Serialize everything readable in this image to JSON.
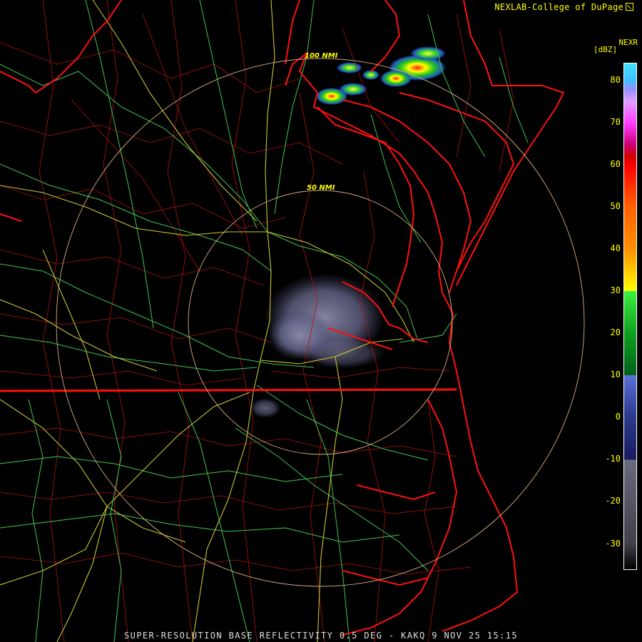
{
  "header": {
    "credit": "NEXLAB-College of DuPage",
    "credit_icon": "external-link-icon",
    "product_code": "NEXR",
    "unit": "[dBZ]"
  },
  "footer": {
    "caption": "SUPER-RESOLUTION BASE REFLECTIVITY 0.5 DEG - KAKQ 9 NOV 25 15:15"
  },
  "range_rings": [
    {
      "label": "50 NMI",
      "nmi": 50
    },
    {
      "label": "100 NMI",
      "nmi": 100
    }
  ],
  "colorbar": {
    "ticks": [
      80,
      70,
      60,
      50,
      40,
      30,
      20,
      10,
      0,
      -10,
      -20,
      -30
    ],
    "range": [
      -36,
      84
    ],
    "stops": [
      {
        "dbz": -36,
        "color": "#000000"
      },
      {
        "dbz": -30,
        "color": "#404048"
      },
      {
        "dbz": -10,
        "color": "#6a6a80"
      },
      {
        "dbz": -10,
        "color": "#1a1a60"
      },
      {
        "dbz": 0,
        "color": "#2a3a8a"
      },
      {
        "dbz": 10,
        "color": "#5a70d8"
      },
      {
        "dbz": 10,
        "color": "#006018"
      },
      {
        "dbz": 20,
        "color": "#10a020"
      },
      {
        "dbz": 30,
        "color": "#40f040"
      },
      {
        "dbz": 30,
        "color": "#ffff00"
      },
      {
        "dbz": 40,
        "color": "#ff9000"
      },
      {
        "dbz": 50,
        "color": "#ff6000"
      },
      {
        "dbz": 60,
        "color": "#ff0000"
      },
      {
        "dbz": 62,
        "color": "#d00000"
      },
      {
        "dbz": 65,
        "color": "#cc0080"
      },
      {
        "dbz": 70,
        "color": "#ff40ff"
      },
      {
        "dbz": 75,
        "color": "#e0a0ff"
      },
      {
        "dbz": 78,
        "color": "#9090ff"
      },
      {
        "dbz": 80,
        "color": "#40c0ff"
      },
      {
        "dbz": 84,
        "color": "#40e0ff"
      }
    ]
  },
  "colors": {
    "state_border": "#ff1010",
    "county_border": "#b01010",
    "highway": "#c8c832",
    "road": "#40c850",
    "range_ring": "#d8b080",
    "label": "#ffff00",
    "background": "#000000"
  }
}
